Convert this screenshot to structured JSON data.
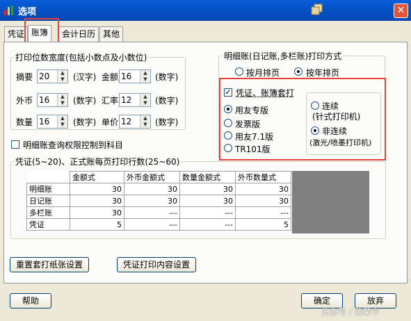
{
  "window": {
    "title": "选项",
    "close_glyph": "✕"
  },
  "tabs": [
    {
      "label": "凭证"
    },
    {
      "label": "账簿"
    },
    {
      "label": "会计日历"
    },
    {
      "label": "其他"
    }
  ],
  "print_width": {
    "title": "打印位数宽度(包括小数点及小数位)",
    "rows": [
      {
        "label": "摘要",
        "value": "20",
        "unit": "(汉字)",
        "label2": "金额",
        "value2": "16",
        "unit2": "(数字)"
      },
      {
        "label": "外币",
        "value": "16",
        "unit": "(数字)",
        "label2": "汇率",
        "value2": "12",
        "unit2": "(数字)"
      },
      {
        "label": "数量",
        "value": "16",
        "unit": "(数字)",
        "label2": "单价",
        "value2": "12",
        "unit2": "(数字)"
      }
    ]
  },
  "detail_print": {
    "title": "明细账(日记账,多栏账)打印方式",
    "by_month": "按月排页",
    "by_year": "按年排页"
  },
  "voucher_book": {
    "checkbox": "凭证、账簿套打",
    "options": [
      "用友专版",
      "发票版",
      "用友7.1版",
      "TR101版"
    ],
    "continuous": "连续",
    "continuous_sub": "(针式打印机)",
    "noncontinuous": "非连续",
    "noncontinuous_sub": "(激光/喷墨打印机)"
  },
  "ledger_permission": "明细账查询权限控制到科目",
  "lines_group": {
    "title": "凭证(5~20)、正式账每页打印行数(25~60)",
    "headers": [
      "金额式",
      "外币金额式",
      "数量金额式",
      "外币数量式"
    ],
    "rows": [
      {
        "name": "明细账",
        "cells": [
          "30",
          "30",
          "30",
          "30"
        ]
      },
      {
        "name": "日记账",
        "cells": [
          "30",
          "30",
          "30",
          "30"
        ]
      },
      {
        "name": "多栏账",
        "cells": [
          "30",
          "---",
          "---",
          "---"
        ]
      },
      {
        "name": "凭证",
        "cells": [
          "5",
          "---",
          "---",
          "5"
        ]
      }
    ]
  },
  "buttons": {
    "reset_paper": "重置套打纸张设置",
    "voucher_print": "凭证打印内容设置",
    "help": "帮助",
    "ok": "确定",
    "cancel": "放弃"
  },
  "watermark": "头条号 / 黄荣宁"
}
